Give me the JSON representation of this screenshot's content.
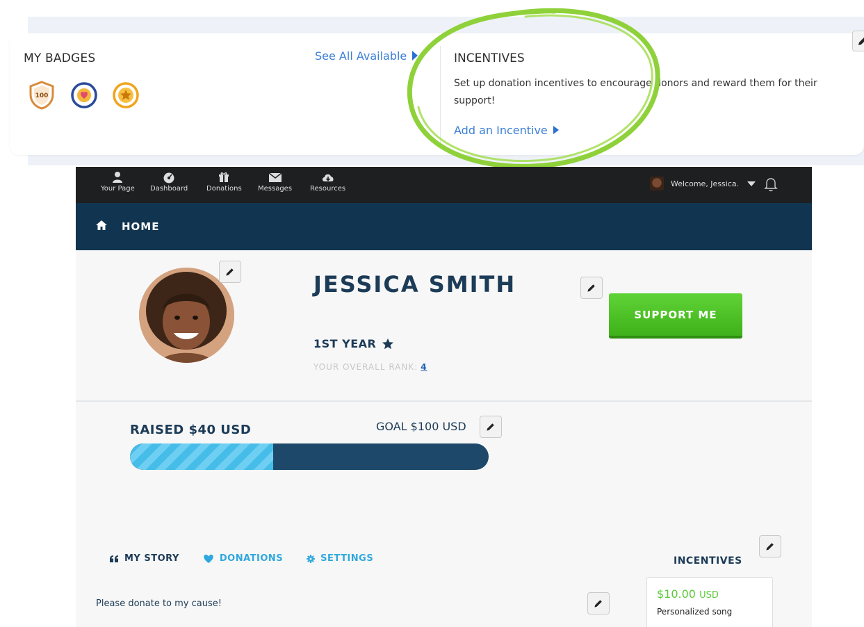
{
  "badges_panel": {
    "title": "MY BADGES",
    "see_all": "See All Available",
    "badges": [
      {
        "icon": "shield-100-badge-icon",
        "label": "100",
        "color": "#d98a3a"
      },
      {
        "icon": "heart-badge-icon",
        "color": "#2a4a9c"
      },
      {
        "icon": "star-badge-icon",
        "color": "#f0a41e"
      }
    ]
  },
  "incentives_panel": {
    "title": "INCENTIVES",
    "description": "Set up donation incentives to encourage donors and reward them for their support!",
    "add_link": "Add an Incentive",
    "highlight_color": "#8fd13a"
  },
  "topnav": {
    "items": [
      {
        "label": "Your Page",
        "icon": "user-icon"
      },
      {
        "label": "Dashboard",
        "icon": "dashboard-icon"
      },
      {
        "label": "Donations",
        "icon": "gift-icon"
      },
      {
        "label": "Messages",
        "icon": "envelope-icon"
      },
      {
        "label": "Resources",
        "icon": "cloud-download-icon"
      }
    ],
    "welcome": "Welcome, Jessica."
  },
  "homebar": {
    "label": "HOME"
  },
  "profile": {
    "name": "JESSICA SMITH",
    "year": "1ST YEAR",
    "rank_label": "YOUR OVERALL RANK:",
    "rank_value": "4",
    "support_button": "SUPPORT ME"
  },
  "fundraising": {
    "raised": "RAISED $40 USD",
    "goal": "GOAL $100 USD",
    "progress_fraction": 0.4
  },
  "tabs": [
    {
      "label": "MY STORY",
      "icon": "quote-icon",
      "color": "#1c3b57"
    },
    {
      "label": "DONATIONS",
      "icon": "heart-icon",
      "color": "#2fa8de"
    },
    {
      "label": "SETTINGS",
      "icon": "gear-icon",
      "color": "#2fa8de"
    }
  ],
  "story": {
    "text": "Please donate to my cause!"
  },
  "incentives_list": {
    "title": "INCENTIVES",
    "items": [
      {
        "amount": "$10.00",
        "currency": "USD",
        "description": "Personalized song"
      }
    ]
  },
  "colors": {
    "navy": "#113550",
    "dark_nav": "#1e1f21",
    "green": "#4cc225",
    "blue_link": "#3b7fd6",
    "progress_fill": "#45bde8"
  }
}
